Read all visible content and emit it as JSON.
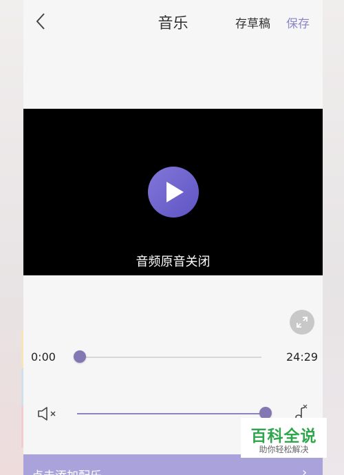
{
  "header": {
    "title": "音乐",
    "draft_label": "存草稿",
    "save_label": "保存"
  },
  "video": {
    "audio_status": "音频原音关闭"
  },
  "playback": {
    "current_time": "0:00",
    "total_time": "24:29",
    "progress": 0.0
  },
  "volume": {
    "level": 1.0,
    "mute_icon": "speaker-muted-icon",
    "music_icon": "music-note-muted-icon"
  },
  "footer": {
    "add_music_label": "点击添加配乐",
    "chevron": "›"
  },
  "watermark": {
    "title": "百科全说",
    "subtitle": "助你轻松解决"
  },
  "colors": {
    "accent": "#8b86c8",
    "play_button": "#6a5fcc",
    "slider": "#8377b4",
    "add_bar": "#aaa3db",
    "watermark_green": "#30a64c"
  }
}
